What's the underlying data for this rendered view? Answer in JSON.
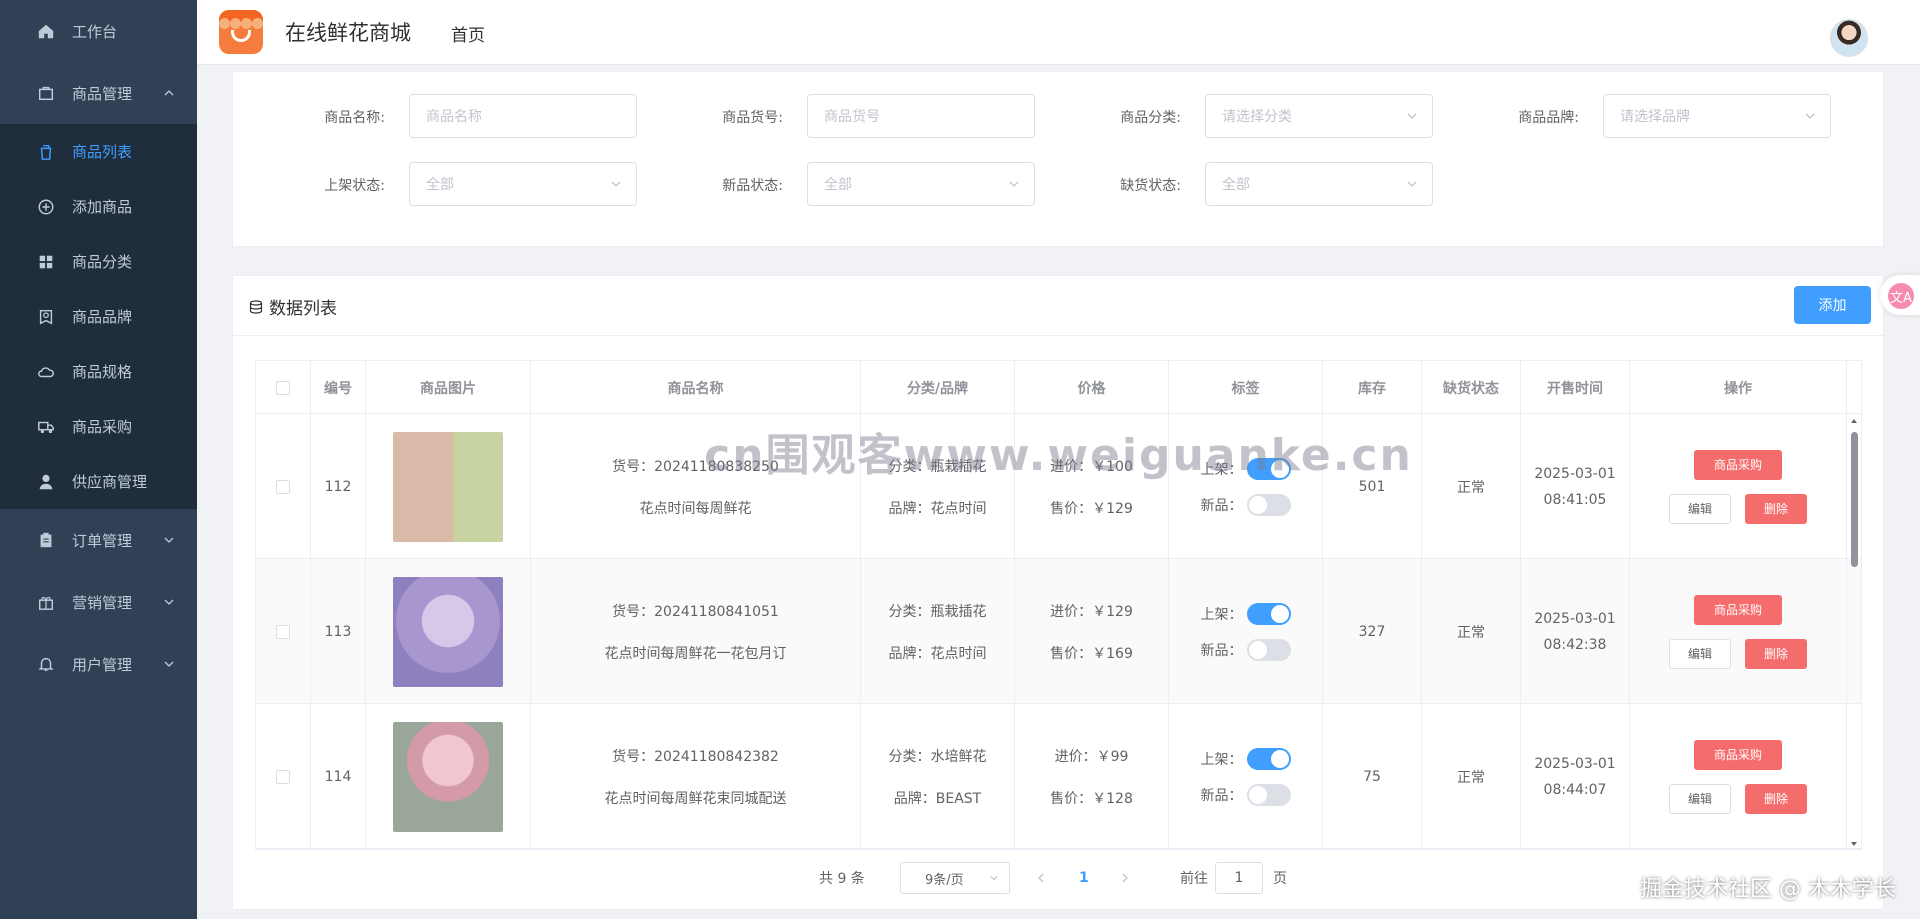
{
  "sidebar": {
    "items": [
      {
        "label": "工作台",
        "icon": "home-icon"
      },
      {
        "label": "商品管理",
        "icon": "bag-icon",
        "expanded": true
      },
      {
        "label": "商品列表",
        "icon": "trash-bag-icon",
        "active": true
      },
      {
        "label": "添加商品",
        "icon": "plus-circle-icon"
      },
      {
        "label": "商品分类",
        "icon": "grid-icon"
      },
      {
        "label": "商品品牌",
        "icon": "badge-icon"
      },
      {
        "label": "商品规格",
        "icon": "cloud-icon"
      },
      {
        "label": "商品采购",
        "icon": "truck-icon"
      },
      {
        "label": "供应商管理",
        "icon": "user-icon"
      },
      {
        "label": "订单管理",
        "icon": "clipboard-icon"
      },
      {
        "label": "营销管理",
        "icon": "gift-icon"
      },
      {
        "label": "用户管理",
        "icon": "bell-icon"
      }
    ]
  },
  "header": {
    "app_title": "在线鲜花商城",
    "breadcrumb": "首页"
  },
  "filters": {
    "name_label": "商品名称:",
    "name_placeholder": "商品名称",
    "sku_label": "商品货号:",
    "sku_placeholder": "商品货号",
    "category_label": "商品分类:",
    "category_placeholder": "请选择分类",
    "brand_label": "商品品牌:",
    "brand_placeholder": "请选择品牌",
    "shelf_label": "上架状态:",
    "shelf_value": "全部",
    "new_label": "新品状态:",
    "new_value": "全部",
    "stock_label": "缺货状态:",
    "stock_value": "全部"
  },
  "list": {
    "title": "数据列表",
    "add_label": "添加"
  },
  "table": {
    "columns": [
      "编号",
      "商品图片",
      "商品名称",
      "分类/品牌",
      "价格",
      "标签",
      "库存",
      "缺货状态",
      "开售时间",
      "操作"
    ],
    "rows": [
      {
        "id": "112",
        "sku": "货号：20241180838250",
        "name": "花点时间每周鲜花",
        "category": "分类：瓶栽插花",
        "brand": "品牌：花点时间",
        "cost": "进价：￥100",
        "price": "售价：￥129",
        "on_shelf_label": "上架：",
        "on_shelf": true,
        "new_label": "新品：",
        "is_new": false,
        "stock": "501",
        "stock_status": "正常",
        "date": "2025-03-01",
        "time": "08:41:05",
        "image_colors": [
          "#e9d6c8",
          "#c7d3a0"
        ]
      },
      {
        "id": "113",
        "sku": "货号：20241180841051",
        "name": "花点时间每周鲜花一花包月订",
        "category": "分类：瓶栽插花",
        "brand": "品牌：花点时间",
        "cost": "进价：￥129",
        "price": "售价：￥169",
        "on_shelf_label": "上架：",
        "on_shelf": true,
        "new_label": "新品：",
        "is_new": false,
        "stock": "327",
        "stock_status": "正常",
        "date": "2025-03-01",
        "time": "08:42:38",
        "image_colors": [
          "#b9a8d8",
          "#8e7fbf"
        ]
      },
      {
        "id": "114",
        "sku": "货号：20241180842382",
        "name": "花点时间每周鲜花束同城配送",
        "category": "分类：水培鲜花",
        "brand": "品牌：BEAST",
        "cost": "进价：￥99",
        "price": "售价：￥128",
        "on_shelf_label": "上架：",
        "on_shelf": true,
        "new_label": "新品：",
        "is_new": false,
        "stock": "75",
        "stock_status": "正常",
        "date": "2025-03-01",
        "time": "08:44:07",
        "image_colors": [
          "#e7b8c3",
          "#9aa69a"
        ]
      }
    ],
    "buy_label": "商品采购",
    "edit_label": "编辑",
    "delete_label": "删除"
  },
  "pager": {
    "total": "共 9 条",
    "page_size": "9条/页",
    "current": "1",
    "goto_prefix": "前往",
    "goto_value": "1",
    "goto_suffix": "页"
  },
  "watermark": "cn围观客www.weiguanke.cn",
  "corner_mark": "掘金技术社区 @ 木木学长",
  "float_glyph": "文A"
}
